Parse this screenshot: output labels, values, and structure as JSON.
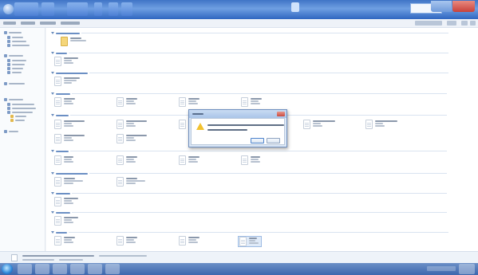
{
  "window": {
    "title": "",
    "controls": [
      "minimize-icon",
      "maximize-icon",
      "close-icon"
    ],
    "title_bar_color": "#3f74c6"
  },
  "menubar": {
    "items": [
      "",
      "",
      ""
    ]
  },
  "navigation_pane": {
    "items": [
      "",
      "",
      "",
      "",
      "",
      "",
      "",
      "",
      "",
      "",
      "",
      "",
      "",
      "",
      "",
      "",
      "",
      "",
      "",
      "",
      "",
      ""
    ]
  },
  "file_groups": [
    {
      "label": "",
      "files": [
        "",
        ""
      ]
    },
    {
      "label": "",
      "files": [
        ""
      ]
    },
    {
      "label": "",
      "files": [
        ""
      ]
    },
    {
      "label": "",
      "files": [
        "",
        "",
        "",
        ""
      ]
    },
    {
      "label": "",
      "files": [
        "",
        "",
        "",
        "",
        "",
        "",
        ""
      ]
    },
    {
      "label": "",
      "files": [
        "",
        "",
        "",
        ""
      ]
    },
    {
      "label": "",
      "files": [
        "",
        ""
      ]
    },
    {
      "label": "",
      "files": [
        ""
      ]
    },
    {
      "label": "",
      "files": [
        ""
      ]
    },
    {
      "label": "",
      "files": [
        "",
        "",
        "",
        ""
      ]
    }
  ],
  "details_pane": {
    "filename": "",
    "detail": ""
  },
  "dialog": {
    "title": "",
    "message": "",
    "question": "",
    "ok_label": "",
    "cancel_label": "",
    "icon": "warning-icon",
    "icon_color": "#f2c230"
  },
  "taskbar": {
    "pinned": [
      "",
      "",
      "",
      "",
      "",
      ""
    ],
    "clock": ""
  }
}
